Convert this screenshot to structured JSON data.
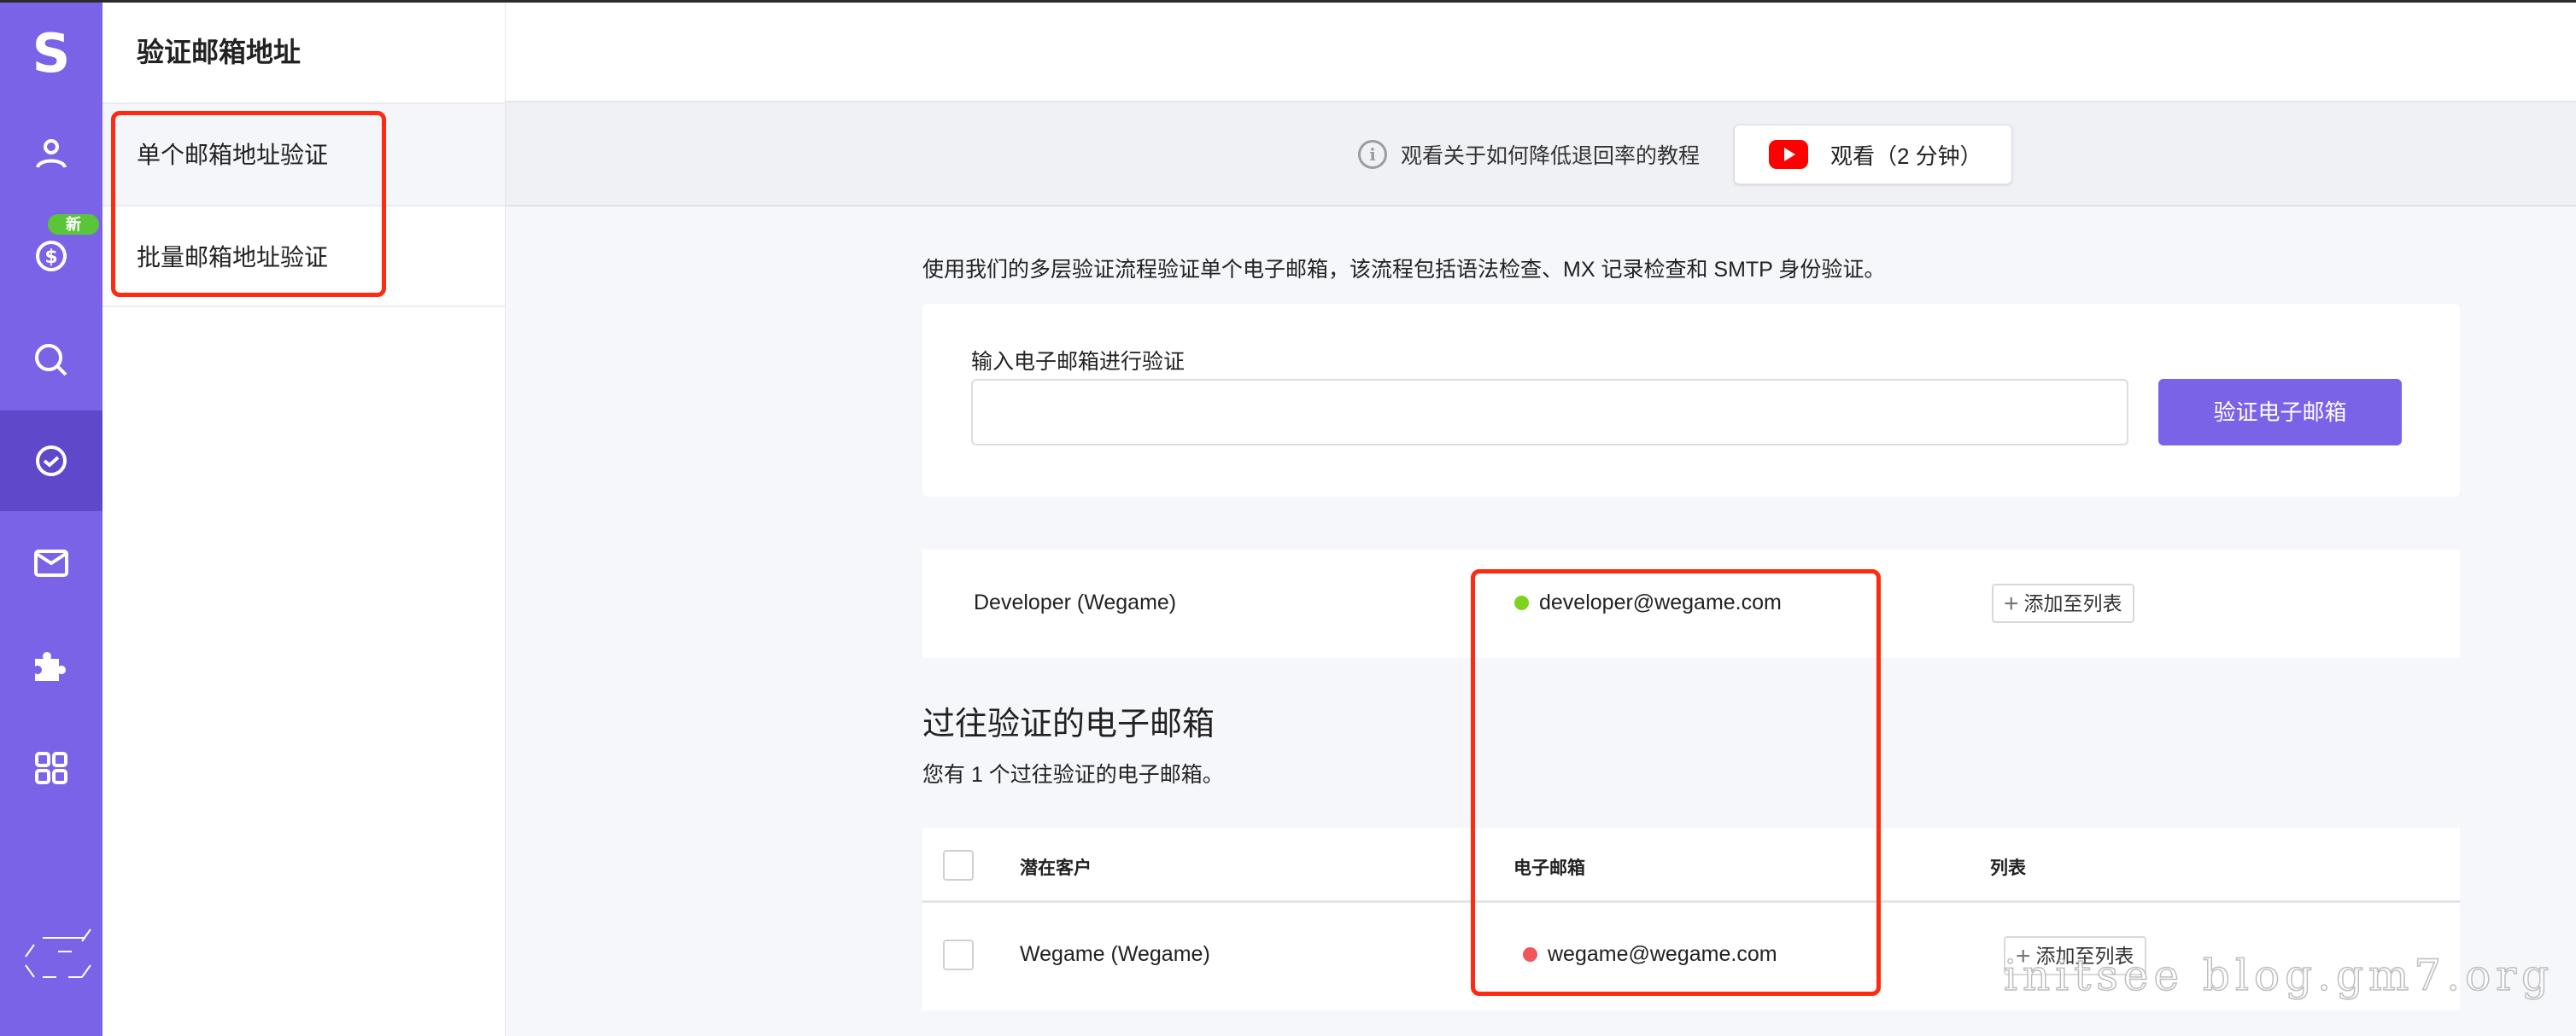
{
  "rail": {
    "logo": "S",
    "badge_new": "新",
    "items": [
      "contacts-icon",
      "pricing-icon",
      "search-icon",
      "verify-icon",
      "mail-icon",
      "extensions-icon",
      "apps-icon"
    ],
    "accent": "#7b63e8",
    "active_color": "#5f48c9"
  },
  "panel": {
    "title": "验证邮箱地址",
    "items": [
      {
        "label": "单个邮箱地址验证",
        "selected": true
      },
      {
        "label": "批量邮箱地址验证",
        "selected": false
      }
    ]
  },
  "banner": {
    "info_text": "观看关于如何降低退回率的教程",
    "watch_label": "观看（2 分钟）"
  },
  "main": {
    "description": "使用我们的多层验证流程验证单个电子邮箱，该流程包括语法检查、MX 记录检查和 SMTP 身份验证。",
    "input_label": "输入电子邮箱进行验证",
    "input_value": "",
    "verify_button": "验证电子邮箱",
    "result": {
      "name": "Developer (Wegame)",
      "email": "developer@wegame.com",
      "status_color": "#7ed321",
      "add_label": "添加至列表"
    },
    "history_title": "过往验证的电子邮箱",
    "history_subtitle": "您有 1 个过往验证的电子邮箱。",
    "table": {
      "headers": [
        "潜在客户",
        "电子邮箱",
        "列表"
      ],
      "rows": [
        {
          "name": "Wegame (Wegame)",
          "email": "wegame@wegame.com",
          "status_color": "#f0565a",
          "add_label": "添加至列表"
        }
      ]
    }
  },
  "watermark": "initsee blog.gm7.org"
}
